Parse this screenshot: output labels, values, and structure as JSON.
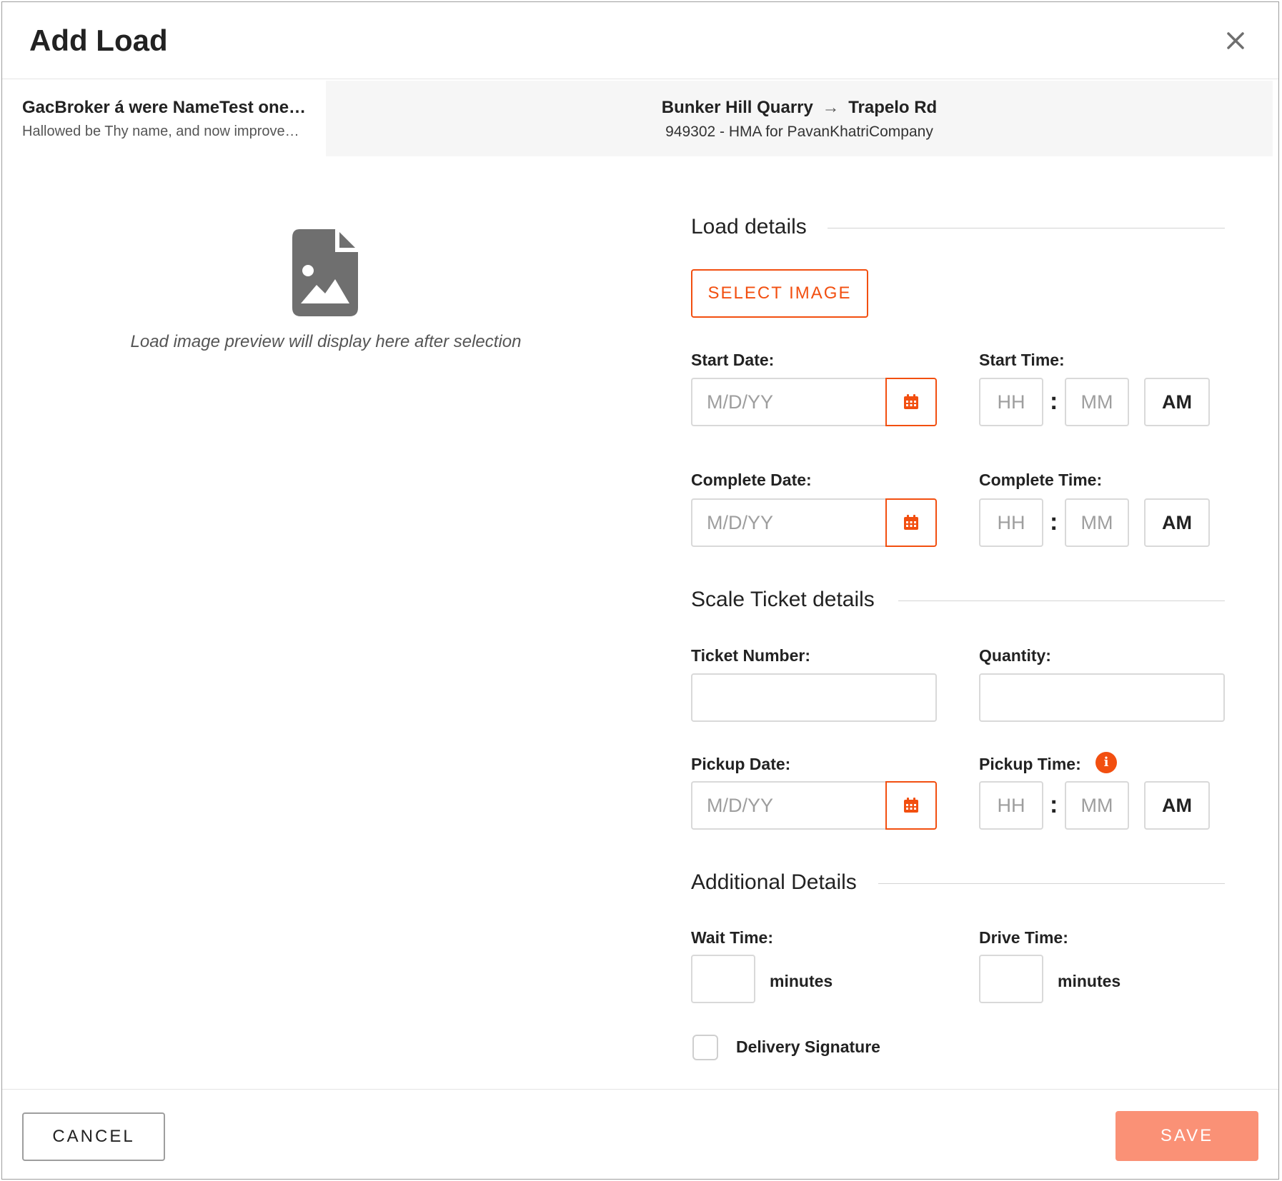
{
  "modal": {
    "title": "Add Load"
  },
  "info_bar": {
    "broker_name": "GacBroker á were NameTest one…",
    "broker_sub": "Hallowed be Thy name, and now improve…",
    "route_from": "Bunker Hill Quarry",
    "route_arrow": "→",
    "route_to": "Trapelo Rd",
    "job_text": "949302 - HMA for PavanKhatriCompany"
  },
  "preview": {
    "text": "Load image preview will display here after selection"
  },
  "load_details": {
    "section_title": "Load details",
    "select_image_label": "SELECT IMAGE",
    "start_date_label": "Start Date:",
    "start_date_placeholder": "M/D/YY",
    "start_time_label": "Start Time:",
    "complete_date_label": "Complete Date:",
    "complete_date_placeholder": "M/D/YY",
    "complete_time_label": "Complete Time:"
  },
  "time_fields": {
    "hour_placeholder": "HH",
    "minute_placeholder": "MM",
    "colon": ":",
    "meridiem": "AM"
  },
  "scale_ticket": {
    "section_title": "Scale Ticket details",
    "ticket_number_label": "Ticket Number:",
    "quantity_label": "Quantity:",
    "pickup_date_label": "Pickup Date:",
    "pickup_date_placeholder": "M/D/YY",
    "pickup_time_label": "Pickup Time:",
    "info_glyph": "i"
  },
  "additional": {
    "section_title": "Additional Details",
    "wait_time_label": "Wait Time:",
    "drive_time_label": "Drive Time:",
    "unit_minutes": "minutes",
    "delivery_signature_label": "Delivery Signature"
  },
  "footer": {
    "cancel_label": "CANCEL",
    "save_label": "SAVE"
  },
  "colors": {
    "accent": "#f24f10",
    "save_disabled": "#fa9176",
    "icon_gray": "#6f6f6f"
  },
  "icons": {
    "close": "close-icon",
    "preview": "image-file-icon",
    "calendar": "calendar-icon",
    "info": "info-icon"
  }
}
